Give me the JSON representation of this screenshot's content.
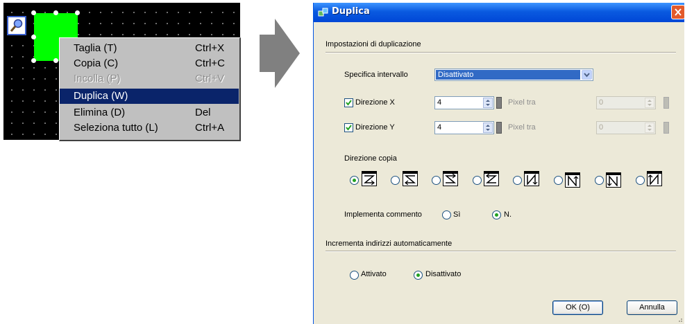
{
  "context_menu": {
    "items": [
      {
        "label": "Taglia (T)",
        "shortcut": "Ctrl+X",
        "state": "normal"
      },
      {
        "label": "Copia (C)",
        "shortcut": "Ctrl+C",
        "state": "normal"
      },
      {
        "label": "Incolla (P)",
        "shortcut": "Ctrl+V",
        "state": "disabled"
      },
      {
        "label": "Duplica (W)",
        "shortcut": "",
        "state": "selected"
      },
      {
        "label": "Elimina (D)",
        "shortcut": "Del",
        "state": "normal"
      },
      {
        "label": "Seleziona tutto (L)",
        "shortcut": "Ctrl+A",
        "state": "normal"
      }
    ]
  },
  "dialog": {
    "title": "Duplica",
    "group1_title": "Impostazioni di duplicazione",
    "specifica_label": "Specifica intervallo",
    "specifica_value": "Disattivato",
    "dir_x": {
      "label": "Direzione X",
      "checked": true,
      "value": "4",
      "pixel_label": "Pixel tra",
      "value2": "0"
    },
    "dir_y": {
      "label": "Direzione Y",
      "checked": true,
      "value": "4",
      "pixel_label": "Pixel tra",
      "value2": "0"
    },
    "copy_direction_label": "Direzione copia",
    "copy_directions_selected_index": 0,
    "commento_label": "Implementa commento",
    "commento_options": [
      "Sì",
      "N."
    ],
    "commento_selected": "N.",
    "group2_title": "Incrementa indirizzi automaticamente",
    "incrementa_options": [
      "Attivato",
      "Disattivato"
    ],
    "incrementa_selected": "Disattivato",
    "ok_label": "OK (O)",
    "cancel_label": "Annulla"
  },
  "colors": {
    "selection": "#0a246a",
    "dialog_bg": "#ece9d8",
    "titlebar": "#0a5ae0",
    "shape_fill": "#00ff00"
  }
}
